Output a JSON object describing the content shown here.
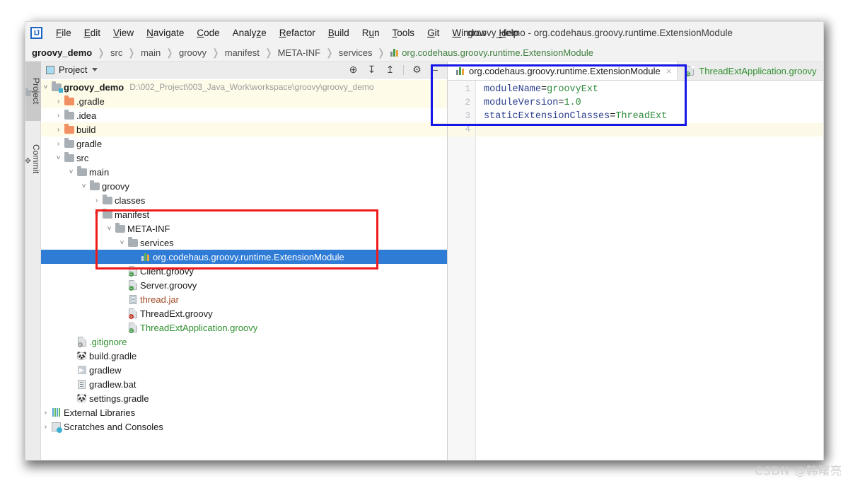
{
  "window": {
    "title": "groovy_demo - org.codehaus.groovy.runtime.ExtensionModule",
    "logo": "IJ"
  },
  "menubar": {
    "items": [
      {
        "label": "File",
        "mnemonic": "F"
      },
      {
        "label": "Edit",
        "mnemonic": "E"
      },
      {
        "label": "View",
        "mnemonic": "V"
      },
      {
        "label": "Navigate",
        "mnemonic": "N"
      },
      {
        "label": "Code",
        "mnemonic": "C"
      },
      {
        "label": "Analyze",
        "mnemonic": "z"
      },
      {
        "label": "Refactor",
        "mnemonic": "R"
      },
      {
        "label": "Build",
        "mnemonic": "B"
      },
      {
        "label": "Run",
        "mnemonic": "u"
      },
      {
        "label": "Tools",
        "mnemonic": "T"
      },
      {
        "label": "Git",
        "mnemonic": "G"
      },
      {
        "label": "Window",
        "mnemonic": "W"
      },
      {
        "label": "Help",
        "mnemonic": "H"
      }
    ]
  },
  "breadcrumb": {
    "items": [
      {
        "label": "groovy_demo",
        "style": "root"
      },
      {
        "label": "src",
        "style": "plain"
      },
      {
        "label": "main",
        "style": "plain"
      },
      {
        "label": "groovy",
        "style": "plain"
      },
      {
        "label": "manifest",
        "style": "plain"
      },
      {
        "label": "META-INF",
        "style": "plain"
      },
      {
        "label": "services",
        "style": "plain"
      },
      {
        "label": "org.codehaus.groovy.runtime.ExtensionModule",
        "style": "file"
      }
    ]
  },
  "toolstrip": {
    "tabs": [
      {
        "label": "Project",
        "active": true,
        "icon": "project-icon"
      },
      {
        "label": "Commit",
        "active": false,
        "icon": "commit-icon"
      }
    ]
  },
  "project_panel": {
    "title": "Project",
    "actions": [
      {
        "name": "select-opened-file-icon",
        "glyph": "⊕"
      },
      {
        "name": "expand-all-icon",
        "glyph": "↧"
      },
      {
        "name": "collapse-all-icon",
        "glyph": "↥"
      },
      {
        "name": "settings-gear-icon",
        "glyph": "⚙"
      },
      {
        "name": "hide-panel-icon",
        "glyph": "−"
      }
    ],
    "tree": [
      {
        "indent": 0,
        "arrow": "down",
        "icon": "module-folder",
        "label": "groovy_demo",
        "bold": true,
        "path": "D:\\002_Project\\003_Java_Work\\workspace\\groovy\\groovy_demo",
        "alt": true
      },
      {
        "indent": 1,
        "arrow": "right",
        "icon": "folder-orange",
        "label": ".gradle",
        "alt": true
      },
      {
        "indent": 1,
        "arrow": "right",
        "icon": "folder-gray",
        "label": ".idea",
        "alt": false
      },
      {
        "indent": 1,
        "arrow": "right",
        "icon": "folder-orange",
        "label": "build",
        "alt": true
      },
      {
        "indent": 1,
        "arrow": "right",
        "icon": "folder-gray",
        "label": "gradle",
        "alt": false
      },
      {
        "indent": 1,
        "arrow": "down",
        "icon": "folder-gray",
        "label": "src",
        "alt": false
      },
      {
        "indent": 2,
        "arrow": "down",
        "icon": "folder-gray",
        "label": "main",
        "alt": false
      },
      {
        "indent": 3,
        "arrow": "down",
        "icon": "folder-gray",
        "label": "groovy",
        "alt": false
      },
      {
        "indent": 4,
        "arrow": "right",
        "icon": "folder-gray",
        "label": "classes",
        "alt": false
      },
      {
        "indent": 4,
        "arrow": "down",
        "icon": "folder-gray",
        "label": "manifest",
        "alt": false
      },
      {
        "indent": 5,
        "arrow": "down",
        "icon": "folder-gray",
        "label": "META-INF",
        "alt": false
      },
      {
        "indent": 6,
        "arrow": "down",
        "icon": "folder-gray",
        "label": "services",
        "alt": false
      },
      {
        "indent": 7,
        "arrow": "none",
        "icon": "properties-file",
        "label": "org.codehaus.groovy.runtime.ExtensionModule",
        "selected": true
      },
      {
        "indent": 6,
        "arrow": "none",
        "icon": "groovy-file",
        "label": "Client.groovy",
        "alt": false
      },
      {
        "indent": 6,
        "arrow": "none",
        "icon": "groovy-file",
        "label": "Server.groovy",
        "alt": false
      },
      {
        "indent": 6,
        "arrow": "none",
        "icon": "jar-file",
        "label": "thread.jar",
        "color": "brown",
        "alt": false
      },
      {
        "indent": 6,
        "arrow": "none",
        "icon": "groovy-file-red",
        "label": "ThreadExt.groovy",
        "alt": false
      },
      {
        "indent": 6,
        "arrow": "none",
        "icon": "groovy-file",
        "label": "ThreadExtApplication.groovy",
        "color": "green",
        "alt": false
      },
      {
        "indent": 1,
        "arrow": "none",
        "icon": "gitignore-file",
        "label": ".gitignore",
        "color": "green",
        "alt": false
      },
      {
        "indent": 1,
        "arrow": "none",
        "icon": "gradle-file",
        "label": "build.gradle",
        "alt": false
      },
      {
        "indent": 1,
        "arrow": "none",
        "icon": "script-file",
        "label": "gradlew",
        "alt": false
      },
      {
        "indent": 1,
        "arrow": "none",
        "icon": "bat-file",
        "label": "gradlew.bat",
        "alt": false
      },
      {
        "indent": 1,
        "arrow": "none",
        "icon": "gradle-file",
        "label": "settings.gradle",
        "alt": false
      },
      {
        "indent": 0,
        "arrow": "right",
        "icon": "libraries-icon",
        "label": "External Libraries",
        "alt": false
      },
      {
        "indent": 0,
        "arrow": "right",
        "icon": "scratches-icon",
        "label": "Scratches and Consoles",
        "alt": false
      }
    ]
  },
  "editor": {
    "tabs": [
      {
        "label": "org.codehaus.groovy.runtime.ExtensionModule",
        "icon": "properties-file",
        "active": true,
        "color": "default",
        "close": "×"
      },
      {
        "label": "ThreadExtApplication.groovy",
        "icon": "groovy-file",
        "active": false,
        "color": "green",
        "close": "×"
      }
    ],
    "line_numbers": [
      "1",
      "2",
      "3",
      "4"
    ],
    "current_line": 4,
    "lines": [
      {
        "key": "moduleName",
        "eq": "=",
        "value": "groovyExt"
      },
      {
        "key": "moduleVersion",
        "eq": "=",
        "value": "1.0"
      },
      {
        "key": "staticExtensionClasses",
        "eq": "=",
        "value": "ThreadExt"
      }
    ]
  },
  "annotations": {
    "red_box_label": "manifest-meta-inf-services-highlight",
    "blue_box_label": "extension-module-editor-highlight",
    "red_color": "#ef1b1b",
    "blue_color": "#1516e8"
  },
  "watermark": {
    "text": "CSDN @韩曙亮"
  }
}
